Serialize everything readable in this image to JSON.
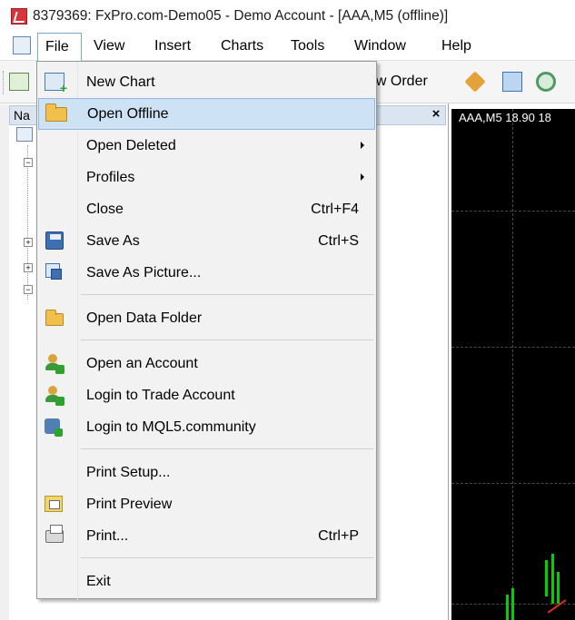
{
  "window": {
    "title": "8379369: FxPro.com-Demo05 - Demo Account - [AAA,M5 (offline)]"
  },
  "menubar": {
    "items": [
      {
        "label": "File"
      },
      {
        "label": "View"
      },
      {
        "label": "Insert"
      },
      {
        "label": "Charts"
      },
      {
        "label": "Tools"
      },
      {
        "label": "Window"
      },
      {
        "label": "Help"
      }
    ]
  },
  "toolbar": {
    "new_order_partial": "ew Order"
  },
  "navigator": {
    "header_partial": "Na",
    "close_glyph": "×"
  },
  "chart": {
    "label": "AAA,M5  18.90 18"
  },
  "file_menu": {
    "items": [
      {
        "label": "New Chart",
        "shortcut": "",
        "icon": "new-chart-icon"
      },
      {
        "label": "Open Offline",
        "shortcut": "",
        "icon": "folder-open-icon",
        "highlighted": true
      },
      {
        "label": "Open Deleted",
        "shortcut": "",
        "submenu": true
      },
      {
        "label": "Profiles",
        "shortcut": "",
        "submenu": true
      },
      {
        "label": "Close",
        "shortcut": "Ctrl+F4"
      },
      {
        "label": "Save As",
        "shortcut": "Ctrl+S",
        "icon": "save-icon"
      },
      {
        "label": "Save As Picture...",
        "shortcut": "",
        "icon": "save-picture-icon"
      },
      {
        "label": "Open Data Folder",
        "shortcut": "",
        "icon": "folder-icon"
      },
      {
        "label": "Open an Account",
        "shortcut": "",
        "icon": "open-account-icon"
      },
      {
        "label": "Login to Trade Account",
        "shortcut": "",
        "icon": "login-icon"
      },
      {
        "label": "Login to MQL5.community",
        "shortcut": "",
        "icon": "mql5-icon"
      },
      {
        "label": "Print Setup...",
        "shortcut": ""
      },
      {
        "label": "Print Preview",
        "shortcut": "",
        "icon": "print-preview-icon"
      },
      {
        "label": "Print...",
        "shortcut": "Ctrl+P",
        "icon": "printer-icon"
      },
      {
        "label": "Exit",
        "shortcut": ""
      }
    ]
  },
  "colors": {
    "menu_bg": "#f2f2f2",
    "highlight_bg": "#cde2f5",
    "highlight_border": "#93b9e0",
    "chart_bg": "#000000",
    "candle": "#00d200",
    "app_icon": "#d8353a"
  }
}
